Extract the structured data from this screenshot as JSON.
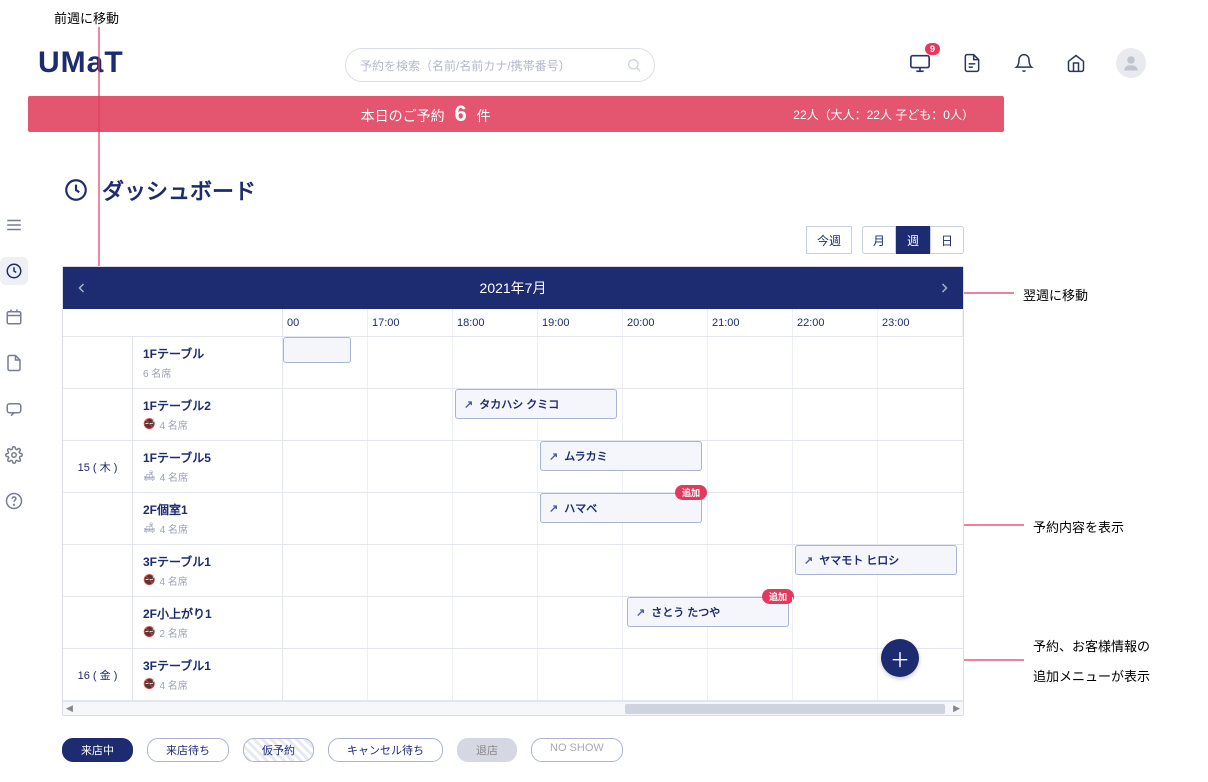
{
  "annotations": {
    "prev": "前週に移動",
    "next": "翌週に移動",
    "show": "予約内容を表示",
    "add1": "予約、お客様情報の",
    "add2": "追加メニューが表示"
  },
  "logo": "UMaT",
  "search": {
    "placeholder": "予約を検索（名前/名前カナ/携帯番号）"
  },
  "top": {
    "badge": "9"
  },
  "banner": {
    "pre": "本日のご予約",
    "num": "6",
    "post": "件",
    "right": "22人（大人：22人 子ども：0人）"
  },
  "page_title": "ダッシュボード",
  "controls": {
    "today": "今週",
    "month": "月",
    "week": "週",
    "day": "日"
  },
  "calendar": {
    "period": "2021年7月"
  },
  "times": [
    "00",
    "17:00",
    "18:00",
    "19:00",
    "20:00",
    "21:00",
    "22:00",
    "23:00"
  ],
  "days": {
    "thu": "15 ( 木 )",
    "fri": "16 ( 金 )"
  },
  "tables": [
    {
      "name": "1Fテーブル",
      "cap": "6 名席",
      "smoking": false
    },
    {
      "name": "1Fテーブル2",
      "cap": "4 名席",
      "smoking": true
    },
    {
      "name": "1Fテーブル5",
      "cap": "4 名席",
      "smoking": false,
      "sofa": true
    },
    {
      "name": "2F個室1",
      "cap": "4 名席",
      "smoking": false,
      "sofa": true
    },
    {
      "name": "3Fテーブル1",
      "cap": "4 名席",
      "smoking": true
    },
    {
      "name": "2F小上がり1",
      "cap": "2 名席",
      "smoking": true
    },
    {
      "name": "3Fテーブル1",
      "cap": "4 名席",
      "smoking": true
    }
  ],
  "reservations": {
    "r1": "タカハシ クミコ",
    "r2": "ムラカミ",
    "r3": "ハマベ",
    "r4": "ヤマモト ヒロシ",
    "r5": "さとう たつや"
  },
  "tag": "追加",
  "legend": [
    "来店中",
    "来店待ち",
    "仮予約",
    "キャンセル待ち",
    "退店",
    "NO SHOW"
  ]
}
